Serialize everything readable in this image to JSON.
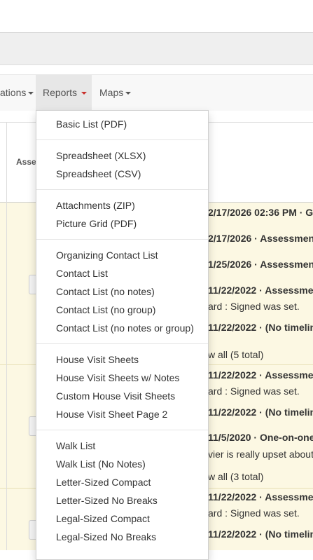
{
  "nav": {
    "items": [
      {
        "label": "ations"
      },
      {
        "label": "Reports"
      },
      {
        "label": "Maps"
      }
    ]
  },
  "table": {
    "header_asse": "Asse"
  },
  "rows": {
    "entries": [
      "2/17/2026 02:36 PM · Gr",
      "2/17/2026 · Assessmen",
      "1/25/2026 · Assessmen",
      "11/22/2022 · Assessme",
      "ard : Signed was set.",
      "11/22/2022 · (No timelin",
      "w all (5 total)",
      "11/22/2022 · Assessme",
      "ard : Signed was set.",
      "11/22/2022 · (No timelin",
      "11/5/2020 · One-on-one",
      "vier is really upset about",
      "w all (3 total)",
      "11/22/2022 · Assessme",
      "ard : Signed was set.",
      "11/22/2022 · (No timelin"
    ]
  },
  "menu": {
    "items": [
      "Basic List (PDF)",
      "Spreadsheet (XLSX)",
      "Spreadsheet (CSV)",
      "Attachments (ZIP)",
      "Picture Grid (PDF)",
      "Organizing Contact List",
      "Contact List",
      "Contact List (no notes)",
      "Contact List (no group)",
      "Contact List (no notes or group)",
      "House Visit Sheets",
      "House Visit Sheets w/ Notes",
      "Custom House Visit Sheets",
      "House Visit Sheet Page 2",
      "Walk List",
      "Walk List (No Notes)",
      "Letter-Sized Compact",
      "Letter-Sized No Breaks",
      "Legal-Sized Compact",
      "Legal-Sized No Breaks"
    ]
  }
}
